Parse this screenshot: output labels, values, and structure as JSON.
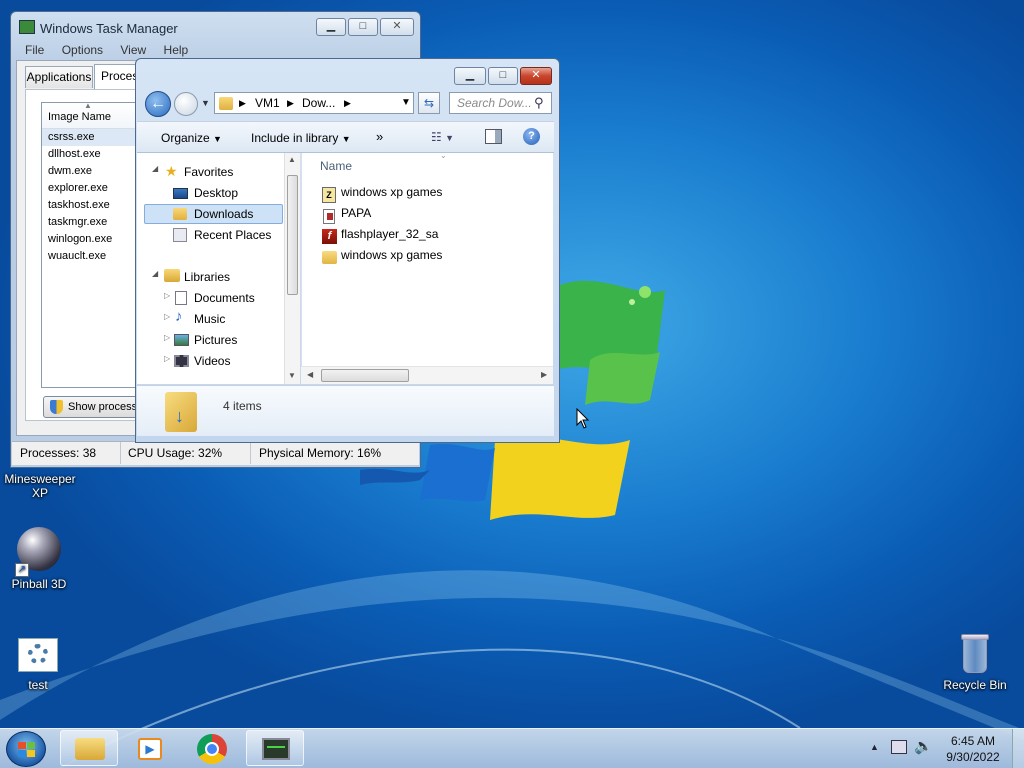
{
  "colors": {
    "taskbar": "#bcd0e6",
    "accent": "#3a78c4",
    "close": "#c9452c"
  },
  "desktop_icons": [
    {
      "label": "Minesweeper XP",
      "icon": "minesweeper-icon"
    },
    {
      "label": "Pinball 3D",
      "icon": "pinball-icon"
    },
    {
      "label": "test",
      "icon": "settings-shortcut-icon"
    },
    {
      "label": "Recycle Bin",
      "icon": "recycle-bin-icon"
    }
  ],
  "task_manager": {
    "title": "Windows Task Manager",
    "menu": [
      "File",
      "Options",
      "View",
      "Help"
    ],
    "tabs": [
      "Applications",
      "Processes"
    ],
    "column_header": "Image Name",
    "processes": [
      "csrss.exe",
      "dllhost.exe",
      "dwm.exe",
      "explorer.exe",
      "taskhost.exe",
      "taskmgr.exe",
      "winlogon.exe",
      "wuauclt.exe"
    ],
    "show_processes_button": "Show processes",
    "status": {
      "processes": "Processes: 38",
      "cpu": "CPU Usage: 32%",
      "memory": "Physical Memory: 16%"
    }
  },
  "explorer": {
    "breadcrumb": [
      "VM1",
      "Dow..."
    ],
    "search_placeholder": "Search Dow...",
    "toolbar": {
      "organize": "Organize",
      "include": "Include in library",
      "more": "»"
    },
    "nav": {
      "favorites": "Favorites",
      "favorites_items": [
        "Desktop",
        "Downloads",
        "Recent Places"
      ],
      "libraries": "Libraries",
      "libraries_items": [
        "Documents",
        "Music",
        "Pictures",
        "Videos"
      ]
    },
    "column_name": "Name",
    "files": [
      {
        "name": "windows xp games",
        "icon": "archive-icon"
      },
      {
        "name": "PAPA",
        "icon": "flash-document-icon"
      },
      {
        "name": "flashplayer_32_sa",
        "icon": "flash-player-icon"
      },
      {
        "name": "windows xp games",
        "icon": "folder-icon"
      }
    ],
    "details": "4 items"
  },
  "taskbar": {
    "time": "6:45 AM",
    "date": "9/30/2022"
  }
}
